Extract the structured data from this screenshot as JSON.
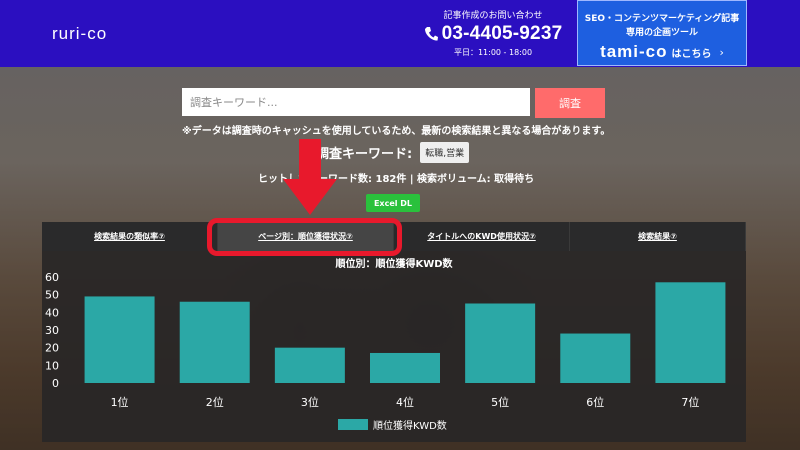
{
  "header": {
    "logo": "ruri-co",
    "contact_label": "記事作成のお問い合わせ",
    "phone": "03-4405-9237",
    "hours": "平日：11:00 - 18:00",
    "promo_line1": "SEO・コンテンツマーケティング記事",
    "promo_line2": "専用の企画ツール",
    "promo_logo": "tami-co",
    "promo_cta": "はこちら",
    "promo_arrow": "›"
  },
  "search": {
    "placeholder": "調査キーワード...",
    "button_label": "調査",
    "notice": "※データは調査時のキャッシュを使用しているため、最新の検索結果と異なる場合があります。"
  },
  "keyword": {
    "label": "調査キーワード:",
    "chip": "転職,営業"
  },
  "stats": "ヒットしたキーワード数: 182件 | 検索ボリューム: 取得待ち",
  "excel_label": "Excel DL",
  "tabs": [
    {
      "label": "検索結果の類似率⑦"
    },
    {
      "label": "ページ別：順位獲得状況⑦"
    },
    {
      "label": "タイトルへのKWD使用状況⑦"
    },
    {
      "label": "検索結果⑦"
    }
  ],
  "colors": {
    "header_bg": "#2b0fc0",
    "promo_bg": "#1e5fe0",
    "bar": "#2ba8a6",
    "highlight": "#e8192c",
    "search_button": "#ff6b6b",
    "excel_button": "#2ac13c"
  },
  "chart_data": {
    "type": "bar",
    "title": "順位別：順位獲得KWD数",
    "categories": [
      "1位",
      "2位",
      "3位",
      "4位",
      "5位",
      "6位",
      "7位"
    ],
    "series": [
      {
        "name": "順位獲得KWD数",
        "values": [
          49,
          46,
          20,
          17,
          45,
          28,
          57
        ]
      }
    ],
    "ylim": [
      0,
      60
    ],
    "yticks": [
      0,
      10,
      20,
      30,
      40,
      50,
      60
    ],
    "legend": "bottom",
    "grid": false
  }
}
